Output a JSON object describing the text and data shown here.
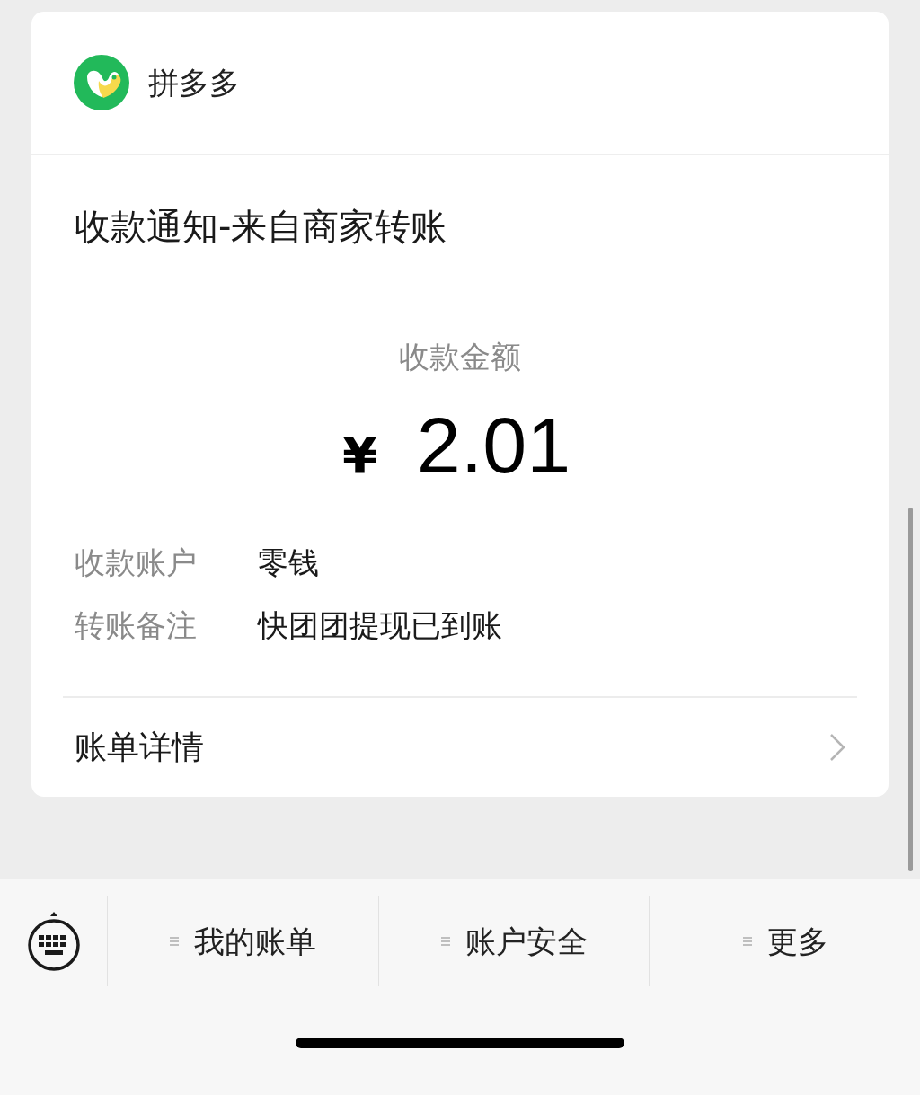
{
  "merchant": {
    "name": "拼多多"
  },
  "notice": {
    "title": "收款通知-来自商家转账",
    "amount_label": "收款金额",
    "currency": "¥",
    "amount": "2.01",
    "fields": [
      {
        "label": "收款账户",
        "value": "零钱"
      },
      {
        "label": "转账备注",
        "value": "快团团提现已到账"
      }
    ],
    "link": "账单详情"
  },
  "menu_bar": {
    "items": [
      "我的账单",
      "账户安全",
      "更多"
    ]
  }
}
